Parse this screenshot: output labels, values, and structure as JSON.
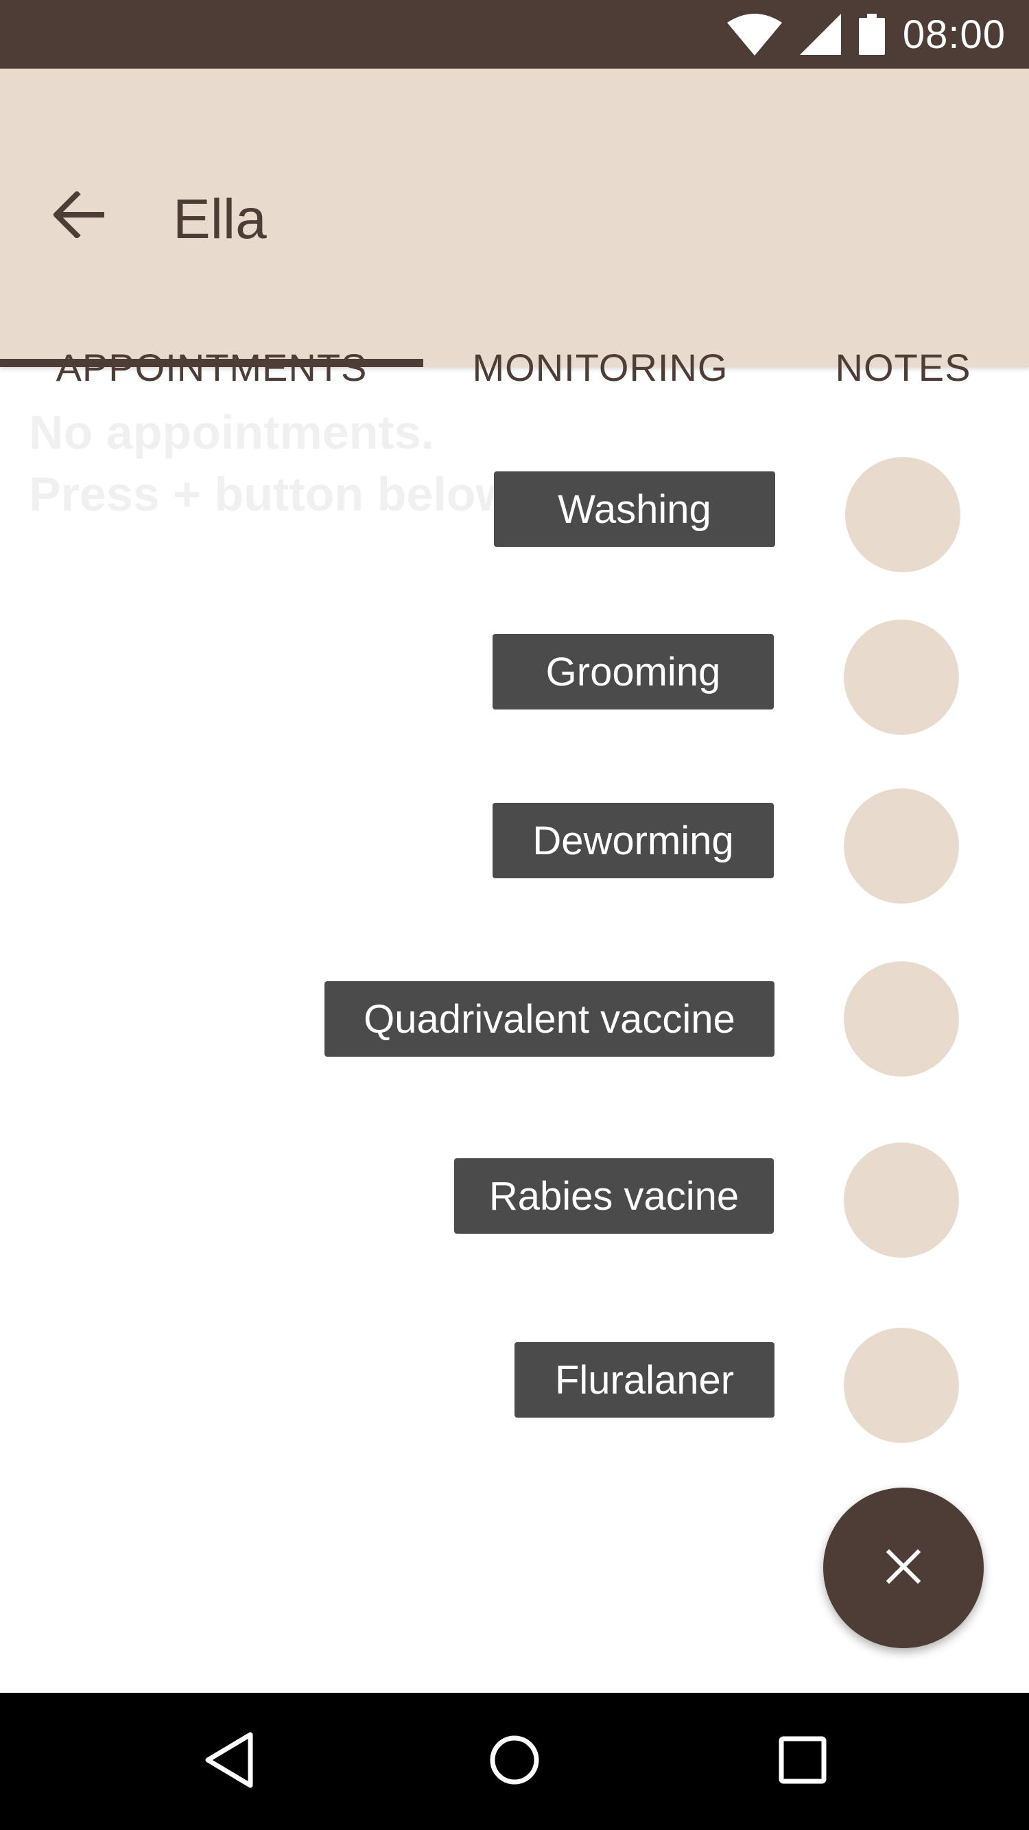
{
  "status_bar": {
    "time": "08:00",
    "icons": [
      "wifi-icon",
      "signal-icon",
      "battery-icon"
    ]
  },
  "app_bar": {
    "title": "Ella",
    "back_icon": "arrow-left-icon"
  },
  "tabs": [
    {
      "label": "APPOINTMENTS",
      "selected": true
    },
    {
      "label": "MONITORING",
      "selected": false
    },
    {
      "label": "NOTES",
      "selected": false
    }
  ],
  "empty_state": {
    "line1": "No appointments.",
    "line2": "Press + button below"
  },
  "speed_dial": {
    "items": [
      {
        "label": "Washing"
      },
      {
        "label": "Grooming"
      },
      {
        "label": "Deworming"
      },
      {
        "label": "Quadrivalent vaccine"
      },
      {
        "label": "Rabies vacine"
      },
      {
        "label": "Fluralaner"
      }
    ],
    "fab_icon": "close-icon"
  },
  "nav_bar": {
    "icons": [
      "back-triangle-icon",
      "home-circle-icon",
      "recents-square-icon"
    ]
  },
  "colors": {
    "primary_dark": "#4e3d36",
    "primary_light": "#e8dbce",
    "label_bg": "#4b4b4b"
  }
}
